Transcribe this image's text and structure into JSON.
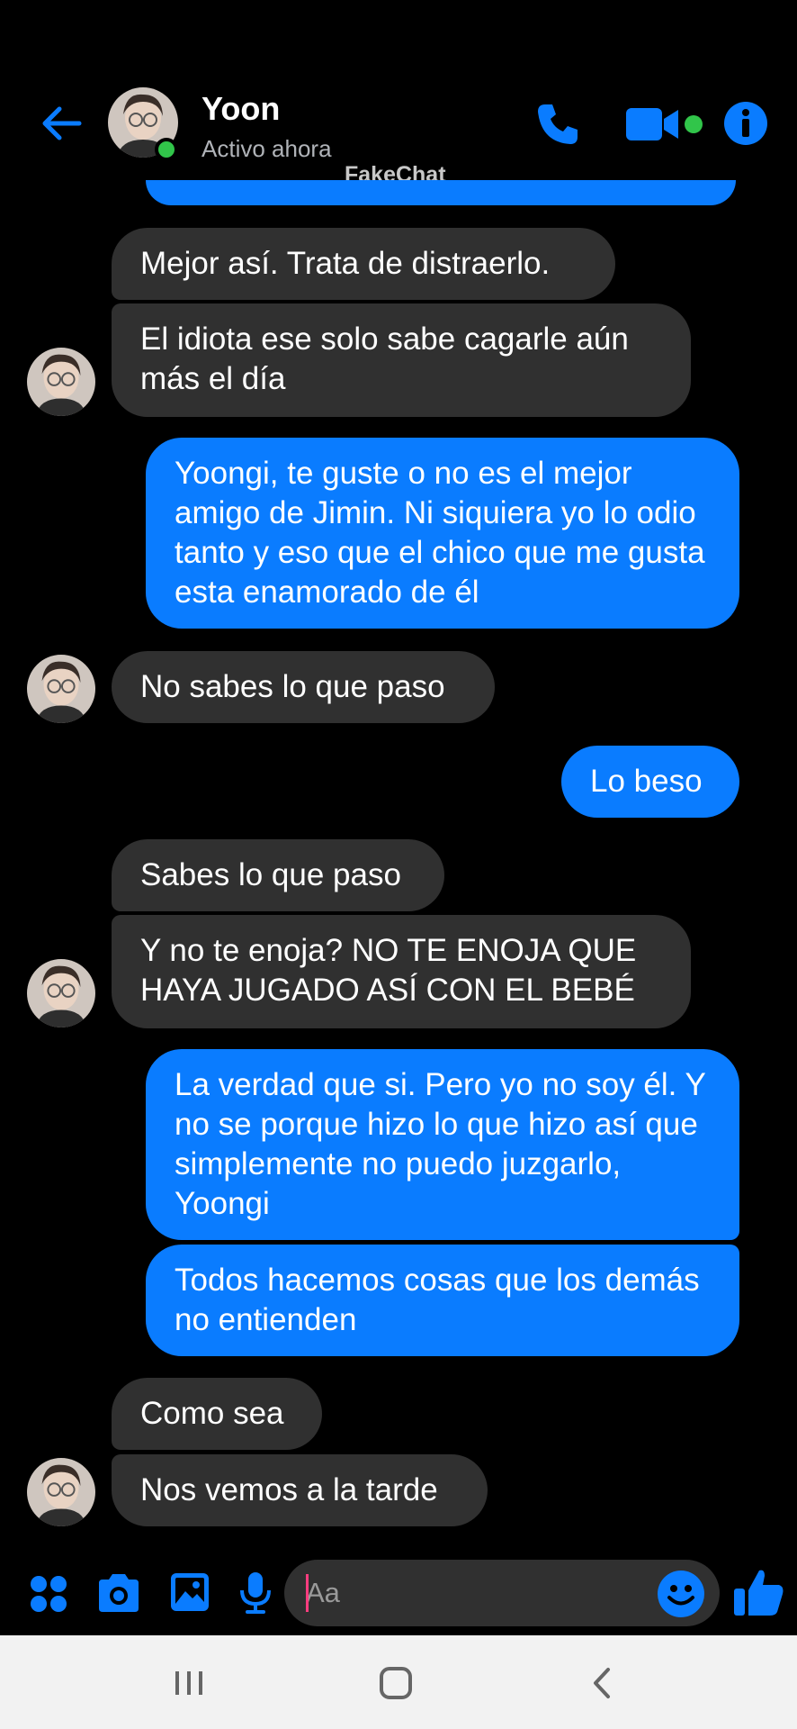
{
  "header": {
    "contact_name": "Yoon",
    "status": "Activo ahora",
    "watermark": "FakeChat"
  },
  "messages": [
    {
      "dir": "in",
      "text": "Mejor así. Trata de distraerlo."
    },
    {
      "dir": "in",
      "text": "El idiota ese solo sabe cagarle aún más el día"
    },
    {
      "dir": "out",
      "text": "Yoongi, te guste o no es el mejor amigo de Jimin. Ni siquiera yo lo odio tanto y eso que el chico que me gusta esta enamorado de él"
    },
    {
      "dir": "in",
      "text": "No sabes lo que paso"
    },
    {
      "dir": "out",
      "text": "Lo beso"
    },
    {
      "dir": "in",
      "text": "Sabes lo que paso"
    },
    {
      "dir": "in",
      "text": "Y no te enoja? NO TE ENOJA QUE HAYA JUGADO ASÍ CON EL BEBÉ"
    },
    {
      "dir": "out",
      "text": "La verdad que si. Pero yo no soy él. Y no se porque hizo lo que hizo así que simplemente no puedo juzgarlo, Yoongi"
    },
    {
      "dir": "out",
      "text": "Todos hacemos cosas que los demás no entienden"
    },
    {
      "dir": "in",
      "text": "Como sea"
    },
    {
      "dir": "in",
      "text": "Nos vemos a la tarde"
    }
  ],
  "composer": {
    "placeholder": "Aa"
  },
  "icons": {
    "back": "arrow-left-icon",
    "call": "phone-icon",
    "video": "video-camera-icon",
    "info": "info-icon",
    "apps": "grid-dots-icon",
    "camera": "camera-icon",
    "gallery": "image-icon",
    "mic": "microphone-icon",
    "emoji": "smiley-icon",
    "like": "thumbs-up-icon",
    "nav_recents": "recents-icon",
    "nav_home": "home-icon",
    "nav_back": "nav-back-icon"
  },
  "colors": {
    "accent": "#0a7cff",
    "incoming_bubble": "#303030",
    "online": "#31c54a",
    "background": "#000000"
  }
}
